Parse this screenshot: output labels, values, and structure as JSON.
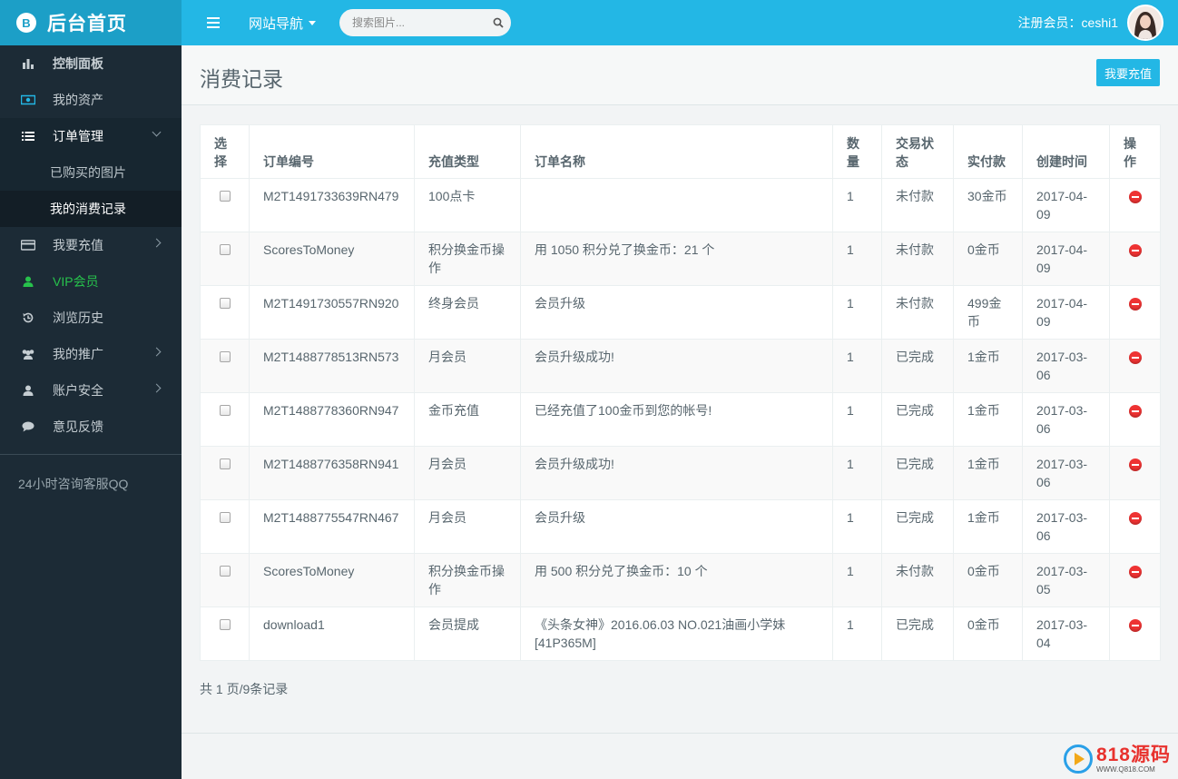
{
  "brand": {
    "logo_char": "B",
    "title": "后台首页"
  },
  "topbar": {
    "site_nav_label": "网站导航",
    "search_placeholder": "搜索图片...",
    "user_label": "注册会员：ceshi1"
  },
  "sidebar": {
    "items": [
      {
        "label": "控制面板",
        "icon": "bar-chart-icon"
      },
      {
        "label": "我的资产",
        "icon": "money-icon"
      },
      {
        "label": "订单管理",
        "icon": "list-icon"
      },
      {
        "label": "已购买的图片"
      },
      {
        "label": "我的消费记录"
      },
      {
        "label": "我要充值",
        "icon": "credit-card-icon"
      },
      {
        "label": "VIP会员",
        "icon": "user-icon"
      },
      {
        "label": "浏览历史",
        "icon": "history-icon"
      },
      {
        "label": "我的推广",
        "icon": "users-icon"
      },
      {
        "label": "账户安全",
        "icon": "user-icon"
      },
      {
        "label": "意见反馈",
        "icon": "comment-icon"
      }
    ],
    "service_text": "24小时咨询客服QQ"
  },
  "page": {
    "title": "消费记录",
    "recharge_button": "我要充值",
    "pager_text": "共 1 页/9条记录"
  },
  "table": {
    "headers": [
      "选择",
      "订单编号",
      "充值类型",
      "订单名称",
      "数量",
      "交易状态",
      "实付款",
      "创建时间",
      "操作"
    ],
    "rows": [
      [
        "M2T1491733639RN479",
        "100点卡",
        "",
        "1",
        "未付款",
        "30金币",
        "2017-04-09"
      ],
      [
        "ScoresToMoney",
        "积分换金币操作",
        "用 1050 积分兑了换金币：21 个",
        "1",
        "未付款",
        "0金币",
        "2017-04-09"
      ],
      [
        "M2T1491730557RN920",
        "终身会员",
        "会员升级",
        "1",
        "未付款",
        "499金币",
        "2017-04-09"
      ],
      [
        "M2T1488778513RN573",
        "月会员",
        "会员升级成功!",
        "1",
        "已完成",
        "1金币",
        "2017-03-06"
      ],
      [
        "M2T1488778360RN947",
        "金币充值",
        "已经充值了100金币到您的帐号!",
        "1",
        "已完成",
        "1金币",
        "2017-03-06"
      ],
      [
        "M2T1488776358RN941",
        "月会员",
        "会员升级成功!",
        "1",
        "已完成",
        "1金币",
        "2017-03-06"
      ],
      [
        "M2T1488775547RN467",
        "月会员",
        "会员升级",
        "1",
        "已完成",
        "1金币",
        "2017-03-06"
      ],
      [
        "ScoresToMoney",
        "积分换金币操作",
        "用 500 积分兑了换金币：10 个",
        "1",
        "未付款",
        "0金币",
        "2017-03-05"
      ],
      [
        "download1",
        "会员提成",
        "《头条女神》2016.06.03 NO.021油画小学妹[41P365M]",
        "1",
        "已完成",
        "0金币",
        "2017-03-04"
      ]
    ]
  },
  "watermark": {
    "text": "818源码",
    "url": "WWW.Q818.COM"
  },
  "colors": {
    "accent": "#23b7e5",
    "sidebar": "#1c2b36",
    "vip": "#27c24c",
    "delete": "#e33333"
  }
}
